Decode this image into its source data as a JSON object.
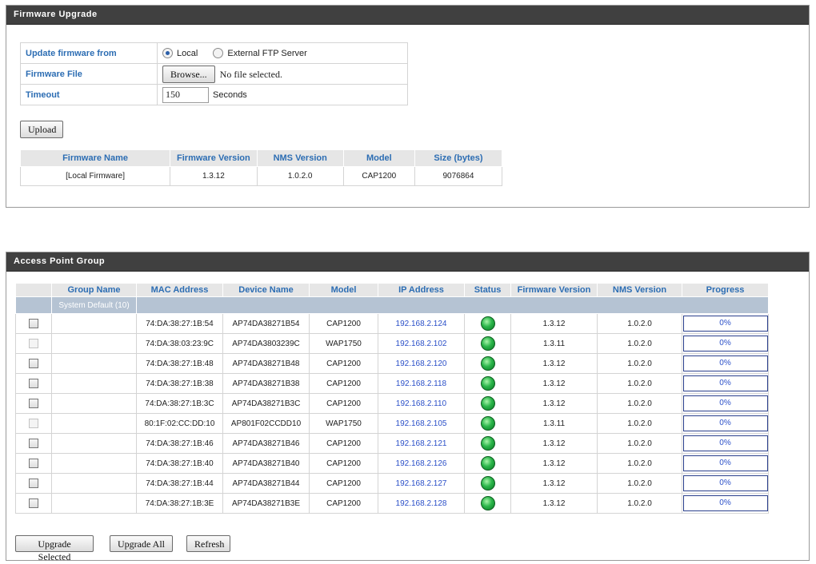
{
  "firmware_upgrade": {
    "title": "Firmware Upgrade",
    "update_from_label": "Update firmware from",
    "update_from_options": [
      "Local",
      "External FTP Server"
    ],
    "update_from_selected": "Local",
    "file_label": "Firmware File",
    "browse_label": "Browse...",
    "no_file_text": "No file selected.",
    "timeout_label": "Timeout",
    "timeout_value": "150",
    "timeout_unit": "Seconds",
    "upload_label": "Upload",
    "table": {
      "headers": [
        "Firmware Name",
        "Firmware Version",
        "NMS Version",
        "Model",
        "Size (bytes)"
      ],
      "rows": [
        [
          "[Local Firmware]",
          "1.3.12",
          "1.0.2.0",
          "CAP1200",
          "9076864"
        ]
      ]
    }
  },
  "access_point_group": {
    "title": "Access Point Group",
    "headers": [
      "",
      "Group Name",
      "MAC Address",
      "Device Name",
      "Model",
      "IP Address",
      "Status",
      "Firmware Version",
      "NMS Version",
      "Progress"
    ],
    "group_label": "System Default (10)",
    "rows": [
      {
        "mac": "74:DA:38:27:1B:54",
        "device": "AP74DA38271B54",
        "model": "CAP1200",
        "ip": "192.168.2.124",
        "fw": "1.3.12",
        "nms": "1.0.2.0",
        "progress": "0%",
        "checkbox_enabled": true
      },
      {
        "mac": "74:DA:38:03:23:9C",
        "device": "AP74DA3803239C",
        "model": "WAP1750",
        "ip": "192.168.2.102",
        "fw": "1.3.11",
        "nms": "1.0.2.0",
        "progress": "0%",
        "checkbox_enabled": false
      },
      {
        "mac": "74:DA:38:27:1B:48",
        "device": "AP74DA38271B48",
        "model": "CAP1200",
        "ip": "192.168.2.120",
        "fw": "1.3.12",
        "nms": "1.0.2.0",
        "progress": "0%",
        "checkbox_enabled": true
      },
      {
        "mac": "74:DA:38:27:1B:38",
        "device": "AP74DA38271B38",
        "model": "CAP1200",
        "ip": "192.168.2.118",
        "fw": "1.3.12",
        "nms": "1.0.2.0",
        "progress": "0%",
        "checkbox_enabled": true
      },
      {
        "mac": "74:DA:38:27:1B:3C",
        "device": "AP74DA38271B3C",
        "model": "CAP1200",
        "ip": "192.168.2.110",
        "fw": "1.3.12",
        "nms": "1.0.2.0",
        "progress": "0%",
        "checkbox_enabled": true
      },
      {
        "mac": "80:1F:02:CC:DD:10",
        "device": "AP801F02CCDD10",
        "model": "WAP1750",
        "ip": "192.168.2.105",
        "fw": "1.3.11",
        "nms": "1.0.2.0",
        "progress": "0%",
        "checkbox_enabled": false
      },
      {
        "mac": "74:DA:38:27:1B:46",
        "device": "AP74DA38271B46",
        "model": "CAP1200",
        "ip": "192.168.2.121",
        "fw": "1.3.12",
        "nms": "1.0.2.0",
        "progress": "0%",
        "checkbox_enabled": true
      },
      {
        "mac": "74:DA:38:27:1B:40",
        "device": "AP74DA38271B40",
        "model": "CAP1200",
        "ip": "192.168.2.126",
        "fw": "1.3.12",
        "nms": "1.0.2.0",
        "progress": "0%",
        "checkbox_enabled": true
      },
      {
        "mac": "74:DA:38:27:1B:44",
        "device": "AP74DA38271B44",
        "model": "CAP1200",
        "ip": "192.168.2.127",
        "fw": "1.3.12",
        "nms": "1.0.2.0",
        "progress": "0%",
        "checkbox_enabled": true
      },
      {
        "mac": "74:DA:38:27:1B:3E",
        "device": "AP74DA38271B3E",
        "model": "CAP1200",
        "ip": "192.168.2.128",
        "fw": "1.3.12",
        "nms": "1.0.2.0",
        "progress": "0%",
        "checkbox_enabled": true
      }
    ],
    "status_color": "#2bb54a",
    "buttons": {
      "upgrade_selected": "Upgrade Selected",
      "upgrade_all": "Upgrade All",
      "refresh": "Refresh"
    }
  }
}
